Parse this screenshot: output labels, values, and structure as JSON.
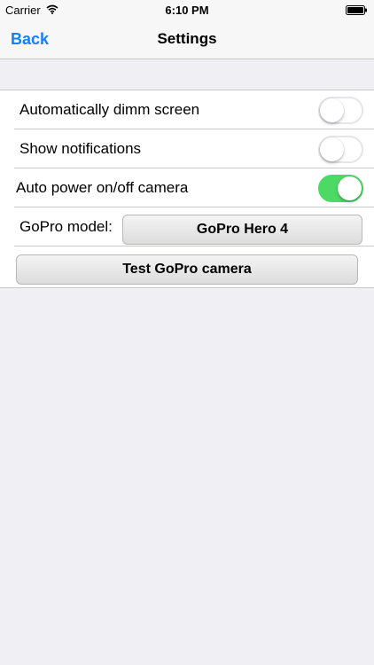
{
  "status_bar": {
    "carrier": "Carrier",
    "time": "6:10 PM",
    "wifi_icon": "wifi-icon",
    "battery_icon": "battery-icon"
  },
  "nav": {
    "back_label": "Back",
    "title": "Settings"
  },
  "settings": {
    "dim_screen": {
      "label": "Automatically dimm screen",
      "enabled": false
    },
    "notifications": {
      "label": "Show notifications",
      "enabled": false
    },
    "auto_power": {
      "label": "Auto power on/off camera",
      "enabled": true
    },
    "gopro_model": {
      "label": "GoPro model:",
      "value": "GoPro Hero 4"
    },
    "test_button_label": "Test GoPro camera"
  },
  "colors": {
    "accent": "#147efb",
    "toggle_on": "#4cd964",
    "background": "#efeff4"
  }
}
